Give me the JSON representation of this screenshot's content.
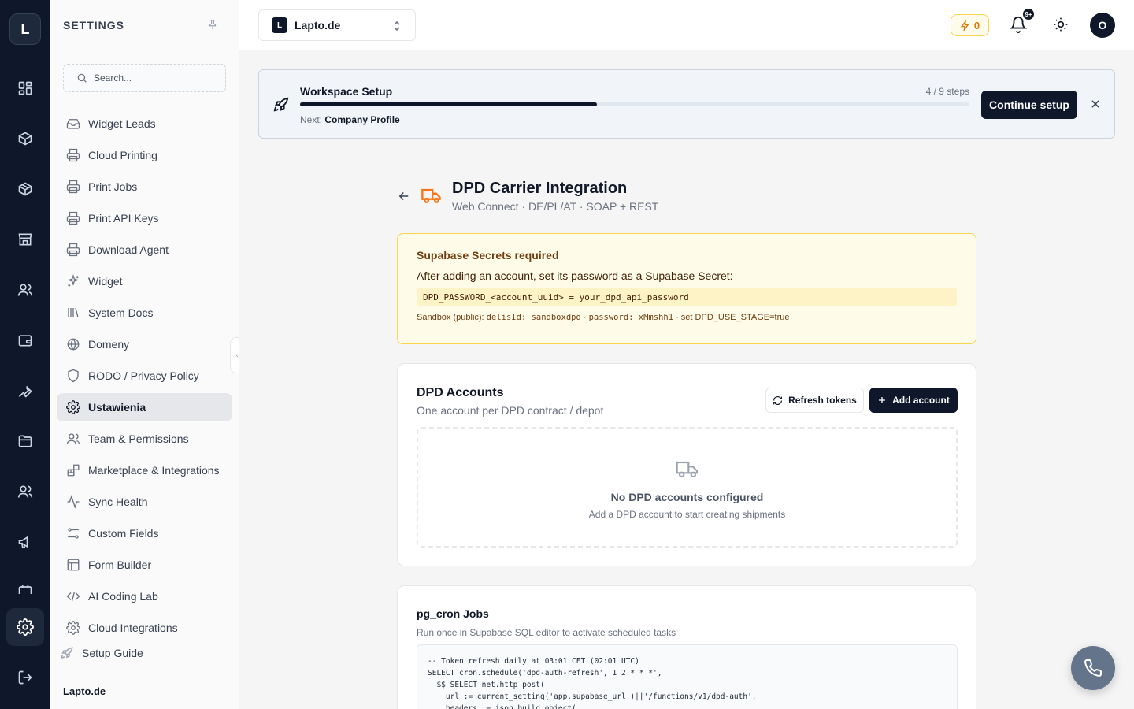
{
  "rail": {
    "logo": "L"
  },
  "sidebar": {
    "title": "SETTINGS",
    "search_placeholder": "Search...",
    "items": [
      {
        "label": "Widget Leads",
        "icon": "inbox-icon"
      },
      {
        "label": "Cloud Printing",
        "icon": "printer-icon"
      },
      {
        "label": "Print Jobs",
        "icon": "printer-icon"
      },
      {
        "label": "Print API Keys",
        "icon": "printer-icon"
      },
      {
        "label": "Download Agent",
        "icon": "printer-icon"
      },
      {
        "label": "Widget",
        "icon": "sparkles-icon"
      },
      {
        "label": "System Docs",
        "icon": "library-icon"
      },
      {
        "label": "Domeny",
        "icon": "globe-icon"
      },
      {
        "label": "RODO / Privacy Policy",
        "icon": "shield-icon"
      },
      {
        "label": "Ustawienia",
        "icon": "gear-icon",
        "active": true
      },
      {
        "label": "Team & Permissions",
        "icon": "users-icon"
      },
      {
        "label": "Marketplace & Integrations",
        "icon": "blocks-icon"
      },
      {
        "label": "Sync Health",
        "icon": "activity-icon"
      },
      {
        "label": "Custom Fields",
        "icon": "sliders-icon"
      },
      {
        "label": "Form Builder",
        "icon": "layout-icon"
      },
      {
        "label": "AI Coding Lab",
        "icon": "code-icon"
      },
      {
        "label": "Cloud Integrations",
        "icon": "gear-icon"
      }
    ],
    "setup_guide": "Setup Guide",
    "footer": "Lapto.de"
  },
  "topbar": {
    "workspace_badge": "L",
    "workspace_name": "Lapto.de",
    "credits": "0",
    "notifications_badge": "9+",
    "avatar": "O"
  },
  "setup": {
    "title": "Workspace Setup",
    "steps": "4 / 9 steps",
    "progress": 0.444,
    "next_label": "Next:",
    "next_value": "Company Profile",
    "button": "Continue setup"
  },
  "page": {
    "title": "DPD Carrier Integration",
    "subtitle": "Web Connect · DE/PL/AT · SOAP + REST"
  },
  "warning": {
    "title": "Supabase Secrets required",
    "text": "After adding an account, set its password as a Supabase Secret:",
    "code": "DPD_PASSWORD_<account_uuid> = your_dpd_api_password",
    "sandbox_prefix": "Sandbox (public):",
    "sandbox_user": "delisId: sandboxdpd",
    "sandbox_sep1": " · ",
    "sandbox_pass": "password: xMmshh1",
    "sandbox_suffix": " · set DPD_USE_STAGE=true"
  },
  "accounts": {
    "title": "DPD Accounts",
    "subtitle": "One account per DPD contract / depot",
    "refresh_button": "Refresh tokens",
    "add_button": "Add account",
    "empty_title": "No DPD accounts configured",
    "empty_subtitle": "Add a DPD account to start creating shipments"
  },
  "cron": {
    "title": "pg_cron Jobs",
    "subtitle": "Run once in Supabase SQL editor to activate scheduled tasks",
    "lines": [
      "-- Token refresh daily at 03:01 CET (02:01 UTC)",
      "SELECT cron.schedule('dpd-auth-refresh','1 2 * * *',",
      "  $$ SELECT net.http_post(",
      "    url := current_setting('app.supabase_url')||'/functions/v1/dpd-auth',",
      "    headers := json_build_object("
    ]
  }
}
